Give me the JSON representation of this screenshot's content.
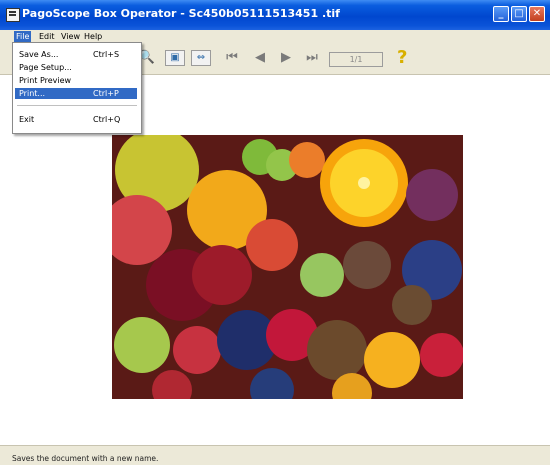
{
  "window": {
    "title": "PagoScope Box Operator - Sc450b05111513451 .tif"
  },
  "menubar": {
    "items": [
      {
        "label": "File"
      },
      {
        "label": "Edit"
      },
      {
        "label": "View"
      },
      {
        "label": "Help"
      }
    ]
  },
  "file_menu": {
    "items": [
      {
        "label": "Save As...",
        "accel": "Ctrl+S"
      },
      {
        "label": "Page Setup..."
      },
      {
        "label": "Print Preview"
      },
      {
        "label": "Print...",
        "accel": "Ctrl+P"
      },
      {
        "label": "Exit",
        "accel": "Ctrl+Q"
      }
    ]
  },
  "toolbar": {
    "page_indicator": "1/1"
  },
  "statusbar": {
    "text": "Saves the document with a new name."
  },
  "icons": [
    "zoom-icon",
    "fit-page-icon",
    "fit-width-icon",
    "first-page-icon",
    "previous-page-icon",
    "next-page-icon",
    "last-page-icon",
    "help-icon"
  ],
  "colors": {
    "title_bar": "#0047cf",
    "menu_highlight": "#316ac5",
    "window_face": "#ece9d8"
  }
}
